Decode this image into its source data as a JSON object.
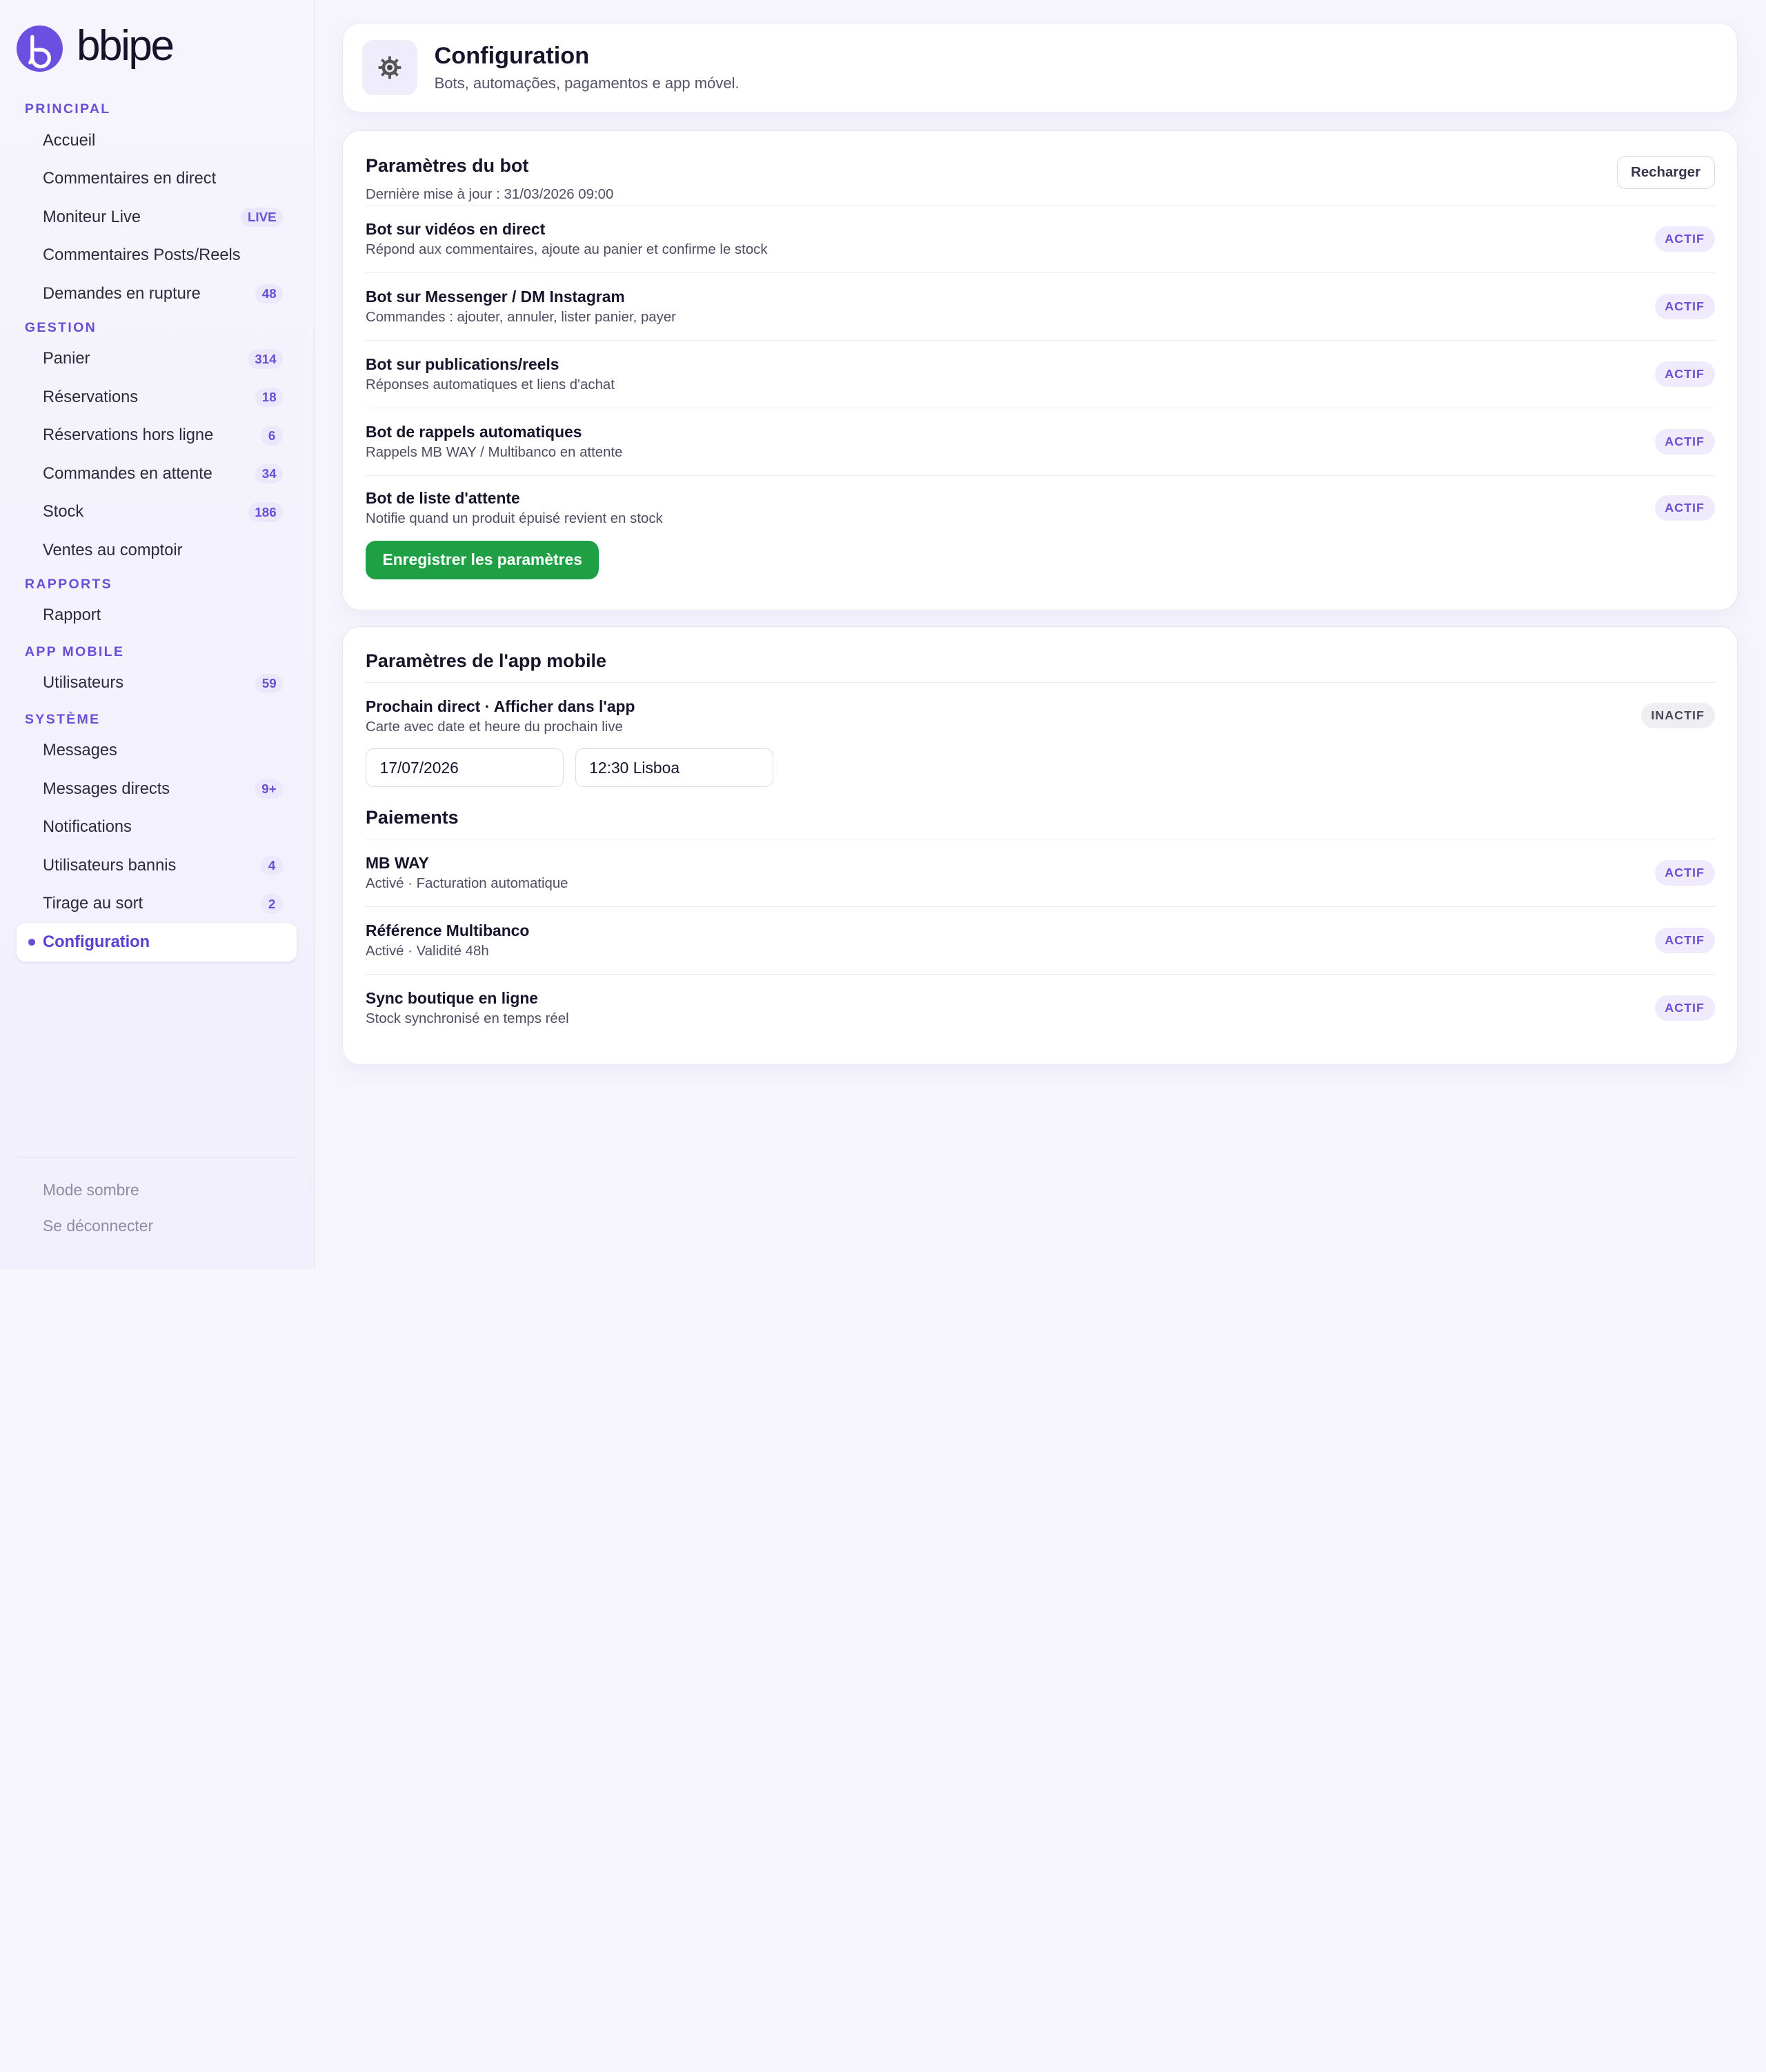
{
  "brand": {
    "name": "bbipe",
    "accent": "#6b4fe0"
  },
  "sidebar": {
    "sections": [
      {
        "title": "PRINCIPAL",
        "items": [
          {
            "label": "Accueil",
            "badge": ""
          },
          {
            "label": "Commentaires en direct",
            "badge": ""
          },
          {
            "label": "Moniteur Live",
            "badge": "LIVE"
          },
          {
            "label": "Commentaires Posts/Reels",
            "badge": ""
          },
          {
            "label": "Demandes en rupture",
            "badge": "48"
          }
        ]
      },
      {
        "title": "GESTION",
        "items": [
          {
            "label": "Panier",
            "badge": "314"
          },
          {
            "label": "Réservations",
            "badge": "18"
          },
          {
            "label": "Réservations hors ligne",
            "badge": "6"
          },
          {
            "label": "Commandes en attente",
            "badge": "34"
          },
          {
            "label": "Stock",
            "badge": "186"
          },
          {
            "label": "Ventes au comptoir",
            "badge": ""
          }
        ]
      },
      {
        "title": "RAPPORTS",
        "items": [
          {
            "label": "Rapport",
            "badge": ""
          }
        ]
      },
      {
        "title": "APP MOBILE",
        "items": [
          {
            "label": "Utilisateurs",
            "badge": "59"
          }
        ]
      },
      {
        "title": "SYSTÈME",
        "items": [
          {
            "label": "Messages",
            "badge": ""
          },
          {
            "label": "Messages directs",
            "badge": "9+"
          },
          {
            "label": "Notifications",
            "badge": ""
          },
          {
            "label": "Utilisateurs bannis",
            "badge": "4"
          },
          {
            "label": "Tirage au sort",
            "badge": "2"
          },
          {
            "label": "Configuration",
            "badge": "",
            "active": true
          }
        ]
      }
    ],
    "footer": {
      "dark_mode": "Mode sombre",
      "logout": "Se déconnecter"
    }
  },
  "header": {
    "icon": "gear-icon",
    "title": "Configuration",
    "subtitle": "Bots, automações, pagamentos e app móvel."
  },
  "bot_settings": {
    "title": "Paramètres du bot",
    "reload_label": "Recharger",
    "last_update": "Dernière mise à jour : 31/03/2026 09:00",
    "rows": [
      {
        "title": "Bot sur vidéos en direct",
        "desc": "Répond aux commentaires, ajoute au panier et confirme le stock",
        "status": "ACTIF"
      },
      {
        "title": "Bot sur Messenger / DM Instagram",
        "desc": "Commandes : ajouter, annuler, lister panier, payer",
        "status": "ACTIF"
      },
      {
        "title": "Bot sur publications/reels",
        "desc": "Réponses automatiques et liens d'achat",
        "status": "ACTIF"
      },
      {
        "title": "Bot de rappels automatiques",
        "desc": "Rappels MB WAY / Multibanco en attente",
        "status": "ACTIF"
      },
      {
        "title": "Bot de liste d'attente",
        "desc": "Notifie quand un produit épuisé revient en stock",
        "status": "ACTIF"
      }
    ],
    "save_label": "Enregistrer les paramètres"
  },
  "app_settings": {
    "title": "Paramètres de l'app mobile",
    "next_live": {
      "title": "Prochain direct · Afficher dans l'app",
      "desc": "Carte avec date et heure du prochain live",
      "status": "INACTIF",
      "date_value": "17/07/2026",
      "time_value": "12:30 Lisboa"
    },
    "payments_title": "Paiements",
    "payments": [
      {
        "title": "MB WAY",
        "desc": "Activé · Facturation automatique",
        "status": "ACTIF"
      },
      {
        "title": "Référence Multibanco",
        "desc": "Activé · Validité 48h",
        "status": "ACTIF"
      },
      {
        "title": "Sync boutique en ligne",
        "desc": "Stock synchronisé en temps réel",
        "status": "ACTIF"
      }
    ]
  },
  "colors": {
    "accent": "#6a4fd6",
    "save": "#1fa045",
    "background": "#f6f5fc"
  }
}
